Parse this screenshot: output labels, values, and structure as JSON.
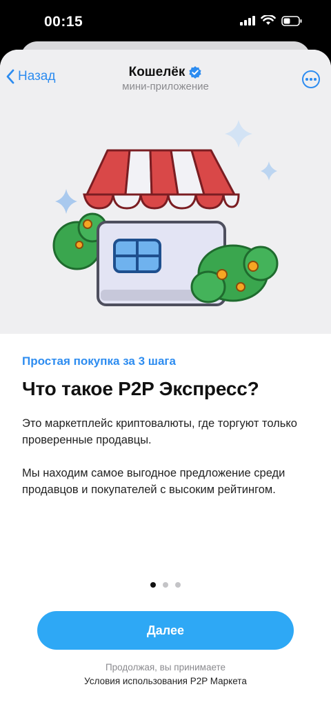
{
  "status_bar": {
    "time": "00:15"
  },
  "header": {
    "back_label": "Назад",
    "title": "Кошелёк",
    "subtitle": "мини-приложение"
  },
  "content": {
    "eyebrow": "Простая покупка за 3 шага",
    "headline": "Что такое P2P Экспресс?",
    "paragraph_1": "Это маркетплейс криптовалюты, где торгуют только проверенные продавцы.",
    "paragraph_2": "Мы находим самое выгодное предложение среди продавцов и покупателей с высоким рейтингом."
  },
  "pagination": {
    "total": 3,
    "active_index": 0
  },
  "actions": {
    "next_label": "Далее"
  },
  "terms": {
    "note": "Продолжая, вы принимаете",
    "link": "Условия использования P2P Маркета"
  },
  "colors": {
    "accent": "#2d8cf0",
    "button": "#2ea8f5",
    "awning_red": "#d94848"
  }
}
